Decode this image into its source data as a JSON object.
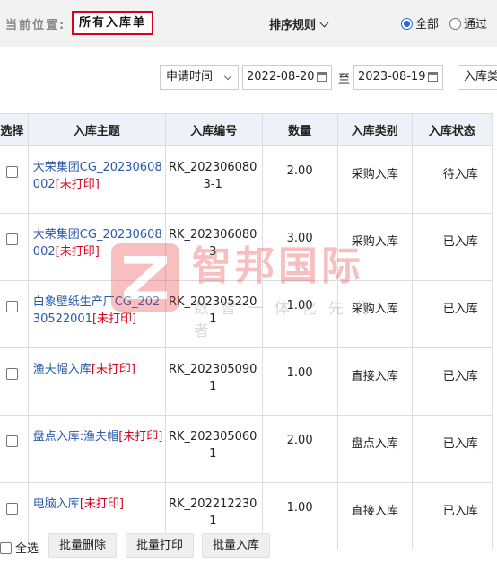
{
  "breadcrumb": {
    "label": "当前位置:",
    "current": "所有入库单"
  },
  "sort_label": "排序规则",
  "radios": [
    {
      "label": "全部",
      "checked": true
    },
    {
      "label": "通过",
      "checked": false
    }
  ],
  "filters": {
    "field_select": "申请时间",
    "date_from": "2022-08-20",
    "separator": "至",
    "date_to": "2023-08-19",
    "type_select": "入库类"
  },
  "table": {
    "headers": [
      "选择",
      "入库主题",
      "入库编号",
      "数量",
      "入库类别",
      "入库状态"
    ],
    "rows": [
      {
        "topic": "大荣集团CG_20230608002",
        "tag": "[未打印]",
        "code": "RK_2023060803-1",
        "qty": "2.00",
        "type": "采购入库",
        "status": "待入库"
      },
      {
        "topic": "大荣集团CG_20230608002",
        "tag": "[未打印]",
        "code": "RK_2023060803",
        "qty": "3.00",
        "type": "采购入库",
        "status": "已入库"
      },
      {
        "topic": "白象壁纸生产厂CG_20230522001",
        "tag": "[未打印]",
        "code": "RK_2023052201",
        "qty": "1.00",
        "type": "采购入库",
        "status": "已入库"
      },
      {
        "topic": "渔夫帽入库",
        "tag": "[未打印]",
        "code": "RK_2023050901",
        "qty": "1.00",
        "type": "直接入库",
        "status": "已入库"
      },
      {
        "topic": "盘点入库:渔夫帽",
        "tag": "[未打印]",
        "code": "RK_2023050601",
        "qty": "2.00",
        "type": "盘点入库",
        "status": "已入库"
      },
      {
        "topic": "电脑入库",
        "tag": "[未打印]",
        "code": "RK_2022122301",
        "qty": "1.00",
        "type": "直接入库",
        "status": "已入库"
      }
    ]
  },
  "bottom": {
    "select_all": "全选",
    "delete_btn": "批量删除",
    "print_btn": "批量打印",
    "stock_btn": "批量入库"
  },
  "watermark": {
    "brand": "智邦国际",
    "slogan": "数智一体化先行者"
  },
  "colors": {
    "accent": "#1e6fd9",
    "link": "#2b5aa8",
    "tag_red": "#d9001b",
    "header_bg": "#eef2f8"
  }
}
